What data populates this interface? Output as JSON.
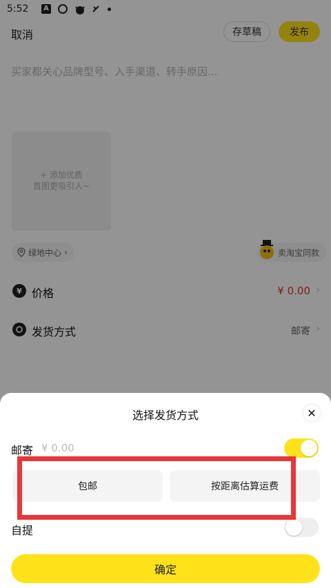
{
  "status_bar": {
    "time": "5:52"
  },
  "top_bar": {
    "cancel": "取消",
    "save_draft": "存草稿",
    "publish": "发布"
  },
  "description": {
    "placeholder": "买家都关心品牌型号、入手渠道、转手原因..."
  },
  "photo": {
    "line1": "+ 添加优质",
    "line2": "首图更吸引人~"
  },
  "location": {
    "label": "绿地中心"
  },
  "same_item": {
    "label": "卖淘宝同款"
  },
  "rows": {
    "price": {
      "label": "价格",
      "value": "¥ 0.00"
    },
    "shipping": {
      "label": "发货方式",
      "value": "邮寄"
    }
  },
  "sheet": {
    "title": "选择发货方式",
    "mail_label": "邮寄",
    "mail_price": "¥ 0.00",
    "options": {
      "free": "包邮",
      "distance": "按距离估算运费"
    },
    "pickup_label": "自提",
    "confirm": "确定"
  },
  "colors": {
    "accent": "#ffe21a",
    "price_red": "#e5302f",
    "highlight": "#e8363a"
  }
}
